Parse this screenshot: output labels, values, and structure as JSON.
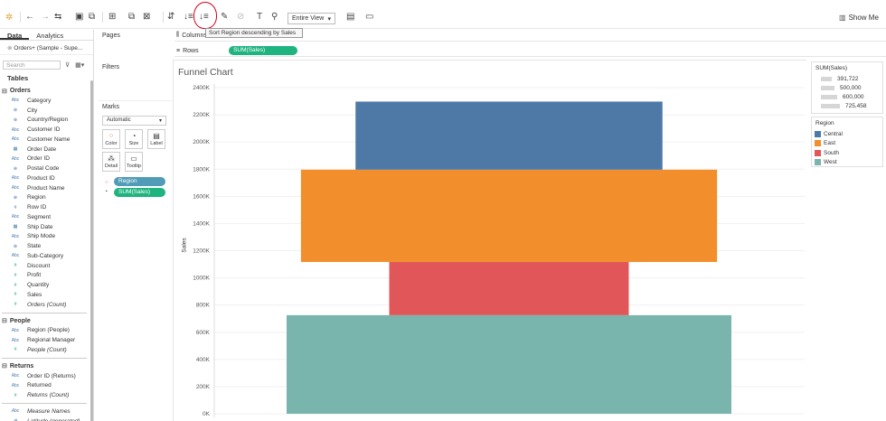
{
  "toolbar": {
    "view_select": "Entire View",
    "show_me": "Show Me",
    "tooltip": "Sort Region descending by Sales"
  },
  "data_pane": {
    "tab_data": "Data",
    "tab_analytics": "Analytics",
    "source": "Orders+ (Sample - Supe...",
    "search_placeholder": "Search",
    "tables_header": "Tables",
    "groups": [
      {
        "name": "Orders",
        "fields": [
          {
            "type": "Abc",
            "name": "Category"
          },
          {
            "type": "geo",
            "name": "City"
          },
          {
            "type": "geo",
            "name": "Country/Region"
          },
          {
            "type": "Abc",
            "name": "Customer ID"
          },
          {
            "type": "Abc",
            "name": "Customer Name"
          },
          {
            "type": "date",
            "name": "Order Date"
          },
          {
            "type": "Abc",
            "name": "Order ID"
          },
          {
            "type": "geo",
            "name": "Postal Code"
          },
          {
            "type": "Abc",
            "name": "Product ID"
          },
          {
            "type": "Abc",
            "name": "Product Name"
          },
          {
            "type": "geo",
            "name": "Region"
          },
          {
            "type": "#",
            "name": "Row ID"
          },
          {
            "type": "Abc",
            "name": "Segment"
          },
          {
            "type": "date",
            "name": "Ship Date"
          },
          {
            "type": "Abc",
            "name": "Ship Mode"
          },
          {
            "type": "geo",
            "name": "State"
          },
          {
            "type": "Abc",
            "name": "Sub-Category"
          },
          {
            "type": "#",
            "name": "Discount",
            "measure": true
          },
          {
            "type": "#",
            "name": "Profit",
            "measure": true
          },
          {
            "type": "#",
            "name": "Quantity",
            "measure": true
          },
          {
            "type": "#",
            "name": "Sales",
            "measure": true
          },
          {
            "type": "#",
            "name": "Orders (Count)",
            "measure": true,
            "italic": true
          }
        ]
      },
      {
        "name": "People",
        "fields": [
          {
            "type": "Abc",
            "name": "Region (People)"
          },
          {
            "type": "Abc",
            "name": "Regional Manager"
          },
          {
            "type": "#",
            "name": "People (Count)",
            "measure": true,
            "italic": true
          }
        ]
      },
      {
        "name": "Returns",
        "fields": [
          {
            "type": "Abc",
            "name": "Order ID (Returns)"
          },
          {
            "type": "Abc",
            "name": "Returned"
          },
          {
            "type": "#",
            "name": "Returns (Count)",
            "measure": true,
            "italic": true
          }
        ]
      }
    ],
    "extra_fields": [
      {
        "type": "Abc",
        "name": "Measure Names",
        "italic": true
      },
      {
        "type": "geo",
        "name": "Latitude (generated)",
        "italic": true
      }
    ]
  },
  "cards": {
    "pages": "Pages",
    "filters": "Filters",
    "marks": "Marks",
    "mark_type": "Automatic",
    "buttons": [
      "Color",
      "Size",
      "Label",
      "Detail",
      "Tooltip"
    ],
    "pill_region": "Region",
    "pill_sales": "SUM(Sales)"
  },
  "shelves": {
    "columns": "Columns",
    "rows": "Rows",
    "rows_pill": "SUM(Sales)"
  },
  "legends": {
    "size_title": "SUM(Sales)",
    "size_items": [
      "391,722",
      "500,000",
      "600,000",
      "725,458"
    ],
    "region_title": "Region",
    "region_items": [
      "Central",
      "East",
      "South",
      "West"
    ]
  },
  "chart_data": {
    "type": "bar",
    "title": "Funnel Chart",
    "ylabel": "Sales",
    "ylim": [
      0,
      2400000
    ],
    "y_ticks": [
      "0K",
      "200K",
      "400K",
      "600K",
      "800K",
      "1000K",
      "1200K",
      "1400K",
      "1600K",
      "1800K",
      "2000K",
      "2200K",
      "2400K"
    ],
    "stacked": true,
    "series": [
      {
        "name": "West",
        "value": 725458,
        "color": "#7ab5ad"
      },
      {
        "name": "South",
        "value": 391722,
        "color": "#e15759"
      },
      {
        "name": "East",
        "value": 678781,
        "color": "#f28e2b"
      },
      {
        "name": "Central",
        "value": 501240,
        "color": "#4e79a7"
      }
    ]
  }
}
